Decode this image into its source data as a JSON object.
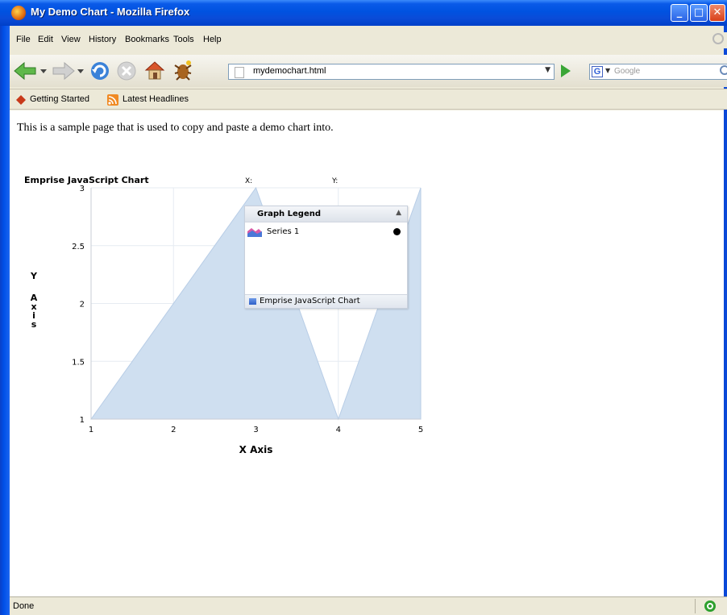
{
  "window": {
    "title": "My Demo Chart - Mozilla Firefox",
    "minimize": "_",
    "maximize": "□",
    "close": "✕"
  },
  "menu": {
    "file": "File",
    "edit": "Edit",
    "view": "View",
    "history": "History",
    "bookmarks": "Bookmarks",
    "tools": "Tools",
    "help": "Help"
  },
  "toolbar": {
    "url": "mydemochart.html",
    "search_placeholder": "Google",
    "search_engine_letter": "G"
  },
  "bookmarks_bar": {
    "items": [
      "Getting Started",
      "Latest Headlines"
    ]
  },
  "page": {
    "intro_text": "This is a sample page that is used to copy and paste a demo chart into."
  },
  "chart_data": {
    "type": "area",
    "title": "Emprise JavaScript Chart",
    "xlabel": "X Axis",
    "ylabel": "Y Axis",
    "crosshair_x_label": "X:",
    "crosshair_y_label": "Y:",
    "x_ticks": [
      "1",
      "2",
      "3",
      "4",
      "5"
    ],
    "y_ticks": [
      "1",
      "1.5",
      "2",
      "2.5",
      "3"
    ],
    "xlim": [
      1,
      5
    ],
    "ylim": [
      1,
      3
    ],
    "grid": true,
    "series": [
      {
        "name": "Series 1",
        "x": [
          1,
          3,
          4,
          5
        ],
        "y": [
          1,
          3,
          1,
          3
        ],
        "color": "#cfdff0"
      }
    ],
    "legend": {
      "title": "Graph Legend",
      "collapse_glyph": "▲",
      "footer": "Emprise JavaScript Chart",
      "placement": "top-right"
    }
  },
  "status": {
    "text": "Done"
  }
}
